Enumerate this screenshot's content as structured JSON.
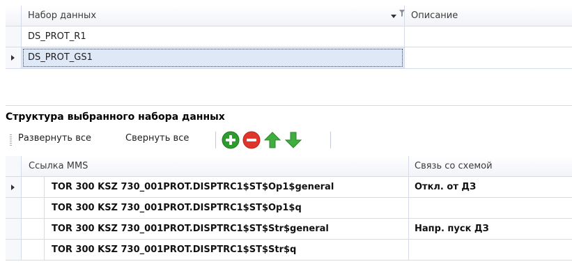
{
  "datasets_grid": {
    "columns": {
      "name": "Набор данных",
      "description": "Описание"
    },
    "rows": [
      {
        "name": "DS_PROT_R1",
        "description": ""
      },
      {
        "name": "DS_PROT_GS1",
        "description": ""
      }
    ],
    "selected_row": 1
  },
  "structure": {
    "title": "Структура выбранного набора данных",
    "toolbar": {
      "expand_all": "Развернуть все",
      "collapse_all": "Свернуть все",
      "icons": [
        "add-icon",
        "remove-icon",
        "move-up-icon",
        "move-down-icon"
      ]
    },
    "columns": {
      "mms_link": "Ссылка MMS",
      "schema_link": "Связь со схемой"
    },
    "rows": [
      {
        "mms": "TOR 300 KSZ 730_001PROT.DISPTRC1$ST$Op1$general",
        "schema": "Откл. от ДЗ"
      },
      {
        "mms": "TOR 300 KSZ 730_001PROT.DISPTRC1$ST$Op1$q",
        "schema": ""
      },
      {
        "mms": "TOR 300 KSZ 730_001PROT.DISPTRC1$ST$Str$general",
        "schema": "Напр. пуск ДЗ"
      },
      {
        "mms": "TOR 300 KSZ 730_001PROT.DISPTRC1$ST$Str$q",
        "schema": ""
      }
    ],
    "selected_row": 0
  },
  "colors": {
    "add": "#2e9b2e",
    "remove": "#e0352b",
    "arrows": "#3fae3f",
    "grid_line": "#d6dbe9",
    "selection": "#dfe8f6"
  }
}
